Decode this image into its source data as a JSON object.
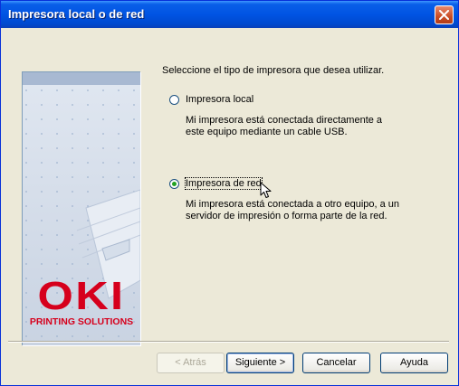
{
  "window": {
    "title": "Impresora local o de red"
  },
  "banner": {
    "logo_text": "OKI",
    "tagline": "PRINTING SOLUTIONS"
  },
  "main": {
    "prompt": "Seleccione el tipo de impresora que desea utilizar.",
    "options": [
      {
        "label": "Impresora local",
        "selected": false,
        "description": "Mi impresora está conectada directamente a este equipo mediante un cable USB."
      },
      {
        "label": "Impresora de red",
        "selected": true,
        "description": "Mi impresora está conectada a otro equipo, a un servidor de impresión o forma parte de la red."
      }
    ]
  },
  "buttons": {
    "back": "< Atrás",
    "next": "Siguiente >",
    "cancel": "Cancelar",
    "help": "Ayuda"
  },
  "colors": {
    "titlebar": "#0054e3",
    "logo_red": "#d6001c",
    "radio_dot": "#21a121",
    "dialog_bg": "#ece9d8"
  }
}
